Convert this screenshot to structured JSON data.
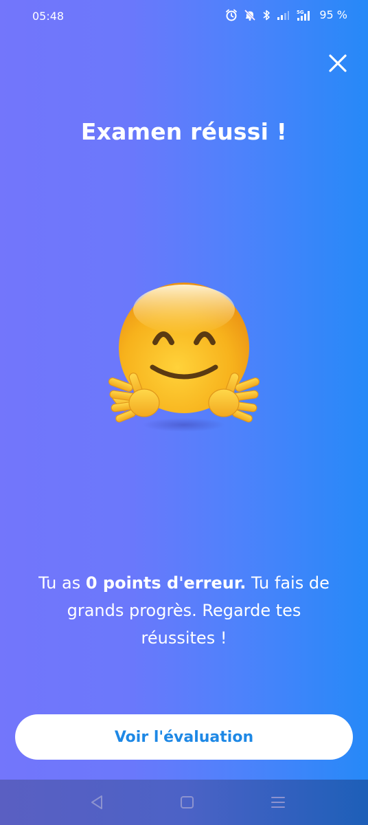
{
  "status_bar": {
    "time": "05:48",
    "battery": "95 %",
    "network": "5G",
    "icons": [
      "alarm-icon",
      "mute-icon",
      "bluetooth-icon",
      "signal-icon",
      "signal-5g-icon"
    ]
  },
  "header": {
    "close_icon": "close-icon"
  },
  "result": {
    "title": "Examen réussi !",
    "emoji": "hugging-face-emoji",
    "message_before": "Tu as ",
    "message_bold": "0 points d'erreur.",
    "message_after": " Tu fais de grands progrès. Regarde tes réussites !"
  },
  "actions": {
    "cta_label": "Voir l'évaluation"
  },
  "nav": {
    "back_icon": "back-icon",
    "home_icon": "home-icon",
    "menu_icon": "menu-icon"
  },
  "colors": {
    "gradient_start": "#7376fb",
    "gradient_end": "#2689f8",
    "cta_text": "#1e88e5",
    "cta_background": "#ffffff"
  }
}
